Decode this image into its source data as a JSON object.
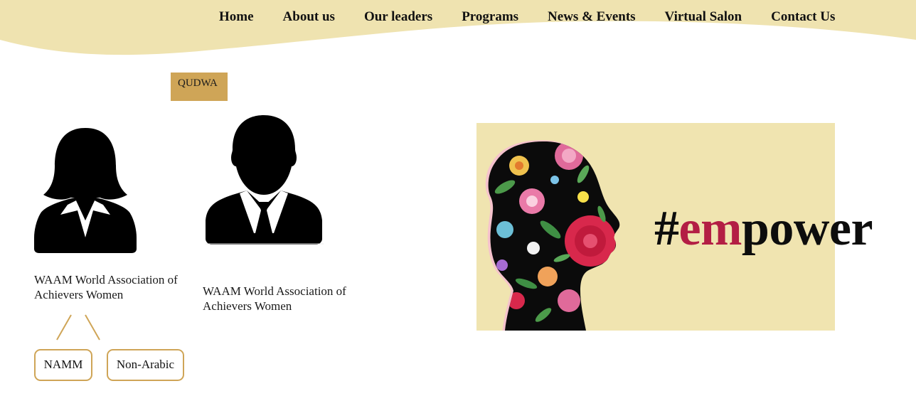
{
  "nav": {
    "items": [
      {
        "label": "Home"
      },
      {
        "label": "About us"
      },
      {
        "label": "Our leaders"
      },
      {
        "label": "Programs"
      },
      {
        "label": "News & Events"
      },
      {
        "label": "Virtual Salon"
      },
      {
        "label": "Contact Us"
      }
    ]
  },
  "badge": {
    "label": "QUDWA"
  },
  "people": [
    {
      "icon": "female-avatar-icon",
      "caption": "WAAM World Association of Achievers Women"
    },
    {
      "icon": "male-avatar-icon",
      "caption": "WAAM World Association of Achievers Women"
    }
  ],
  "children": [
    {
      "label": "NAMM"
    },
    {
      "label": "Non-Arabic"
    }
  ],
  "banner": {
    "hash": "#",
    "highlight": "em",
    "rest": "power",
    "background": "#f0e4b0",
    "accent": "#b31e44",
    "icon": "floral-woman-silhouette-icon"
  },
  "colors": {
    "header": "#efe3b0",
    "gold": "#cfa557"
  }
}
